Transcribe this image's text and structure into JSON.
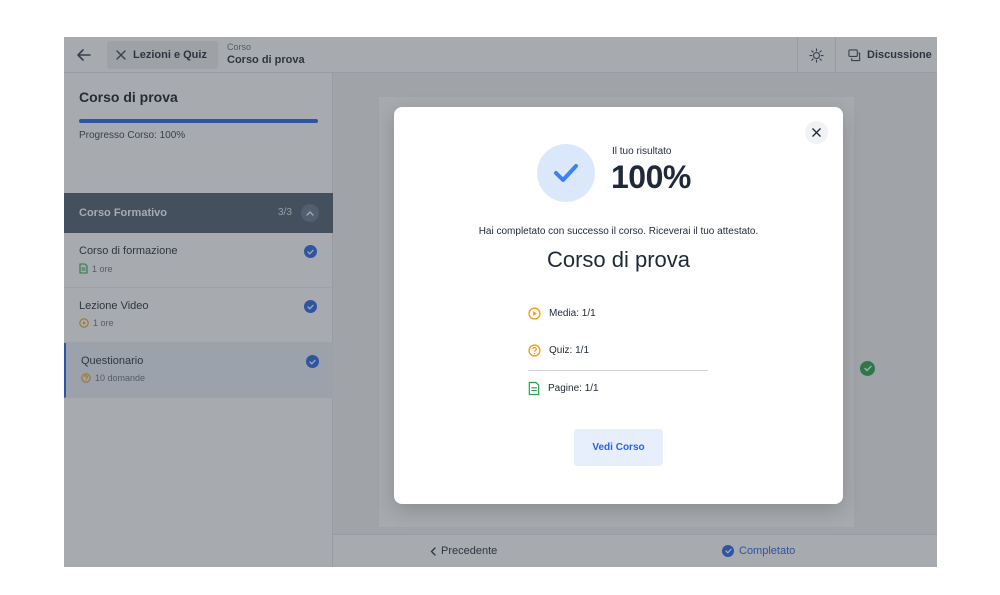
{
  "topbar": {
    "close_label": "Lezioni e Quiz",
    "crumb_top": "Corso",
    "crumb_main": "Corso di prova",
    "discussion_label": "Discussione",
    "back_icon": "arrow-left-icon",
    "theme_icon": "sun-icon"
  },
  "sidebar": {
    "course_title": "Corso di prova",
    "progress_percent": 100,
    "progress_label": "Progresso Corso: 100%",
    "section": {
      "title": "Corso Formativo",
      "count": "3/3"
    },
    "lessons": [
      {
        "title": "Corso di formazione",
        "meta": "1 ore",
        "icon": "document-icon",
        "icon_color": "#22a447",
        "completed": true
      },
      {
        "title": "Lezione Video",
        "meta": "1 ore",
        "icon": "play-icon",
        "icon_color": "#f59e0b",
        "completed": true
      },
      {
        "title": "Questionario",
        "meta": "10 domande",
        "icon": "quiz-icon",
        "icon_color": "#f59e0b",
        "completed": true
      }
    ]
  },
  "footer": {
    "prev_label": "Precedente",
    "done_label": "Completato"
  },
  "modal": {
    "result_label": "Il tuo risultato",
    "result_value": "100%",
    "success_message": "Hai completato con successo il corso. Riceverai il tuo attestato.",
    "course_name": "Corso di prova",
    "stats": [
      {
        "label": "Media: 1/1",
        "icon": "play-icon",
        "color": "#f59e0b"
      },
      {
        "label": "Quiz: 1/1",
        "icon": "quiz-icon",
        "color": "#f59e0b"
      },
      {
        "label": "Pagine: 1/1",
        "icon": "document-icon",
        "color": "#22a447"
      }
    ],
    "view_button": "Vedi Corso"
  },
  "colors": {
    "accent": "#2563eb",
    "section_header": "#4b5b6e",
    "success": "#22a447",
    "warning": "#f59e0b"
  }
}
